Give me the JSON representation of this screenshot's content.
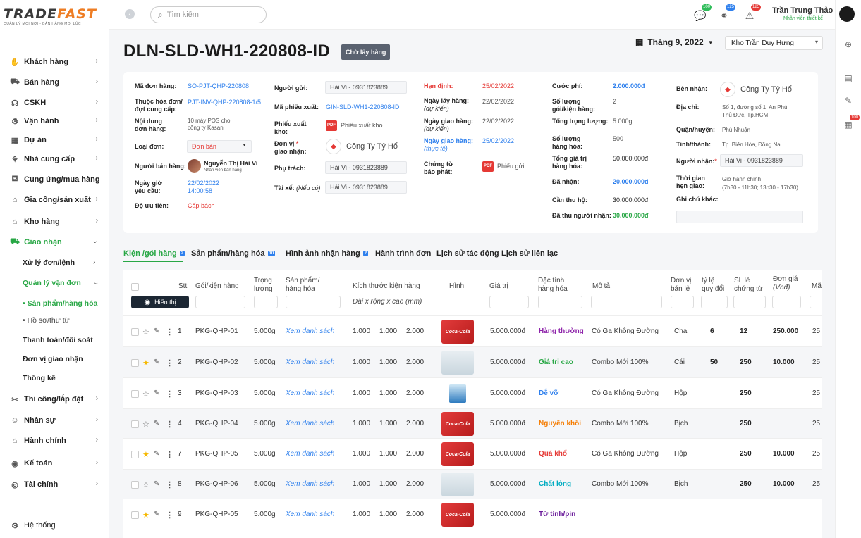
{
  "brand": {
    "name_a": "TRADE",
    "name_b": "FAST",
    "tagline": "QUẢN LÝ MỌI NƠI - BÁN HÀNG MỌI LÚC"
  },
  "sidebar": {
    "items": [
      {
        "label": "Khách hàng",
        "icon": "handshake-icon"
      },
      {
        "label": "Bán hàng",
        "icon": "cart-icon"
      },
      {
        "label": "CSKH",
        "icon": "headset-icon"
      },
      {
        "label": "Vận hành",
        "icon": "gear-icon"
      },
      {
        "label": "Dự án",
        "icon": "building-icon"
      },
      {
        "label": "Nhà cung cấp",
        "icon": "supplier-icon"
      },
      {
        "label": "Cung ứng/mua hàng",
        "icon": "basket-icon"
      },
      {
        "label": "Gia công/sản xuất",
        "icon": "factory-icon"
      },
      {
        "label": "Kho hàng",
        "icon": "warehouse-icon"
      },
      {
        "label": "Giao nhận",
        "icon": "truck-icon"
      },
      {
        "label": "Thi công/lắp đặt",
        "icon": "tools-icon"
      },
      {
        "label": "Nhân sự",
        "icon": "people-icon"
      },
      {
        "label": "Hành chính",
        "icon": "bank-icon"
      },
      {
        "label": "Kế toán",
        "icon": "coin-icon"
      },
      {
        "label": "Tài chính",
        "icon": "money-icon"
      }
    ],
    "sub": [
      "Xử lý đơn/lệnh",
      "Quản lý vận đơn",
      "Thanh toán/đối soát",
      "Đơn vị giao nhận",
      "Thống kê"
    ],
    "subsub": [
      "Sản phẩm/hàng hóa",
      "Hồ sơ/thư từ"
    ],
    "footer": "Hệ thống"
  },
  "topbar": {
    "search_placeholder": "Tìm kiếm",
    "badges": [
      "100",
      "125",
      "125"
    ],
    "user_name": "Trần Trung Thảo",
    "user_role": "Nhân viên thiết kế",
    "rail_badge": "100"
  },
  "page": {
    "title": "DLN-SLD-WH1-220808-ID",
    "status": "Chờ lấy hàng",
    "month": "Tháng 9, 2022",
    "warehouse": "Kho Trần Duy Hưng"
  },
  "info": {
    "ma_don_hang_l": "Mã đơn hàng:",
    "ma_don_hang": "SO-PJT-QHP-220808",
    "thuoc_hd_l1": "Thuộc hóa đơn/",
    "thuoc_hd_l2": "đợt cung cấp:",
    "thuoc_hd": "PJT-INV-QHP-220808-1/5",
    "noi_dung_l1": "Nội dung",
    "noi_dung_l2": "đơn hàng:",
    "noi_dung_1": "10 máy POS cho",
    "noi_dung_2": "công ty Kasan",
    "loai_don_l": "Loại đơn:",
    "loai_don": "Đơn bán",
    "nguoi_ban_l": "Người bán hàng:",
    "nguoi_ban": "Nguyễn Thị Hải Vi",
    "nguoi_ban_role": "Nhân viên bán hàng",
    "ngay_gio_l1": "Ngày giờ",
    "ngay_gio_l2": "yêu cầu:",
    "ngay_gio_1": "22/02/2022",
    "ngay_gio_2": "14:00:58",
    "uu_tien_l": "Độ ưu tiên:",
    "uu_tien": "Cấp bách",
    "nguoi_gui_l": "Người gửi:",
    "nguoi_gui": "Hải Vi - 0931823889",
    "ma_phieu_l": "Mã phiếu xuất:",
    "ma_phieu": "GIN-SLD-WH1-220808-ID",
    "phieu_xuat_l1": "Phiếu xuất",
    "phieu_xuat_l2": "kho:",
    "phieu_xuat": "Phiếu xuất kho",
    "don_vi_l1": "Đơn vị",
    "don_vi_l2": "giao nhận:",
    "don_vi": "Công Ty Tỷ Hổ",
    "phu_trach_l": "Phụ trách:",
    "phu_trach": "Hải Vi - 0931823889",
    "tai_xe_l": "Tài xế:",
    "tai_xe_note": "(Nếu có)",
    "tai_xe": "Hải Vi - 0931823889",
    "han_dinh_l": "Hạn định:",
    "han_dinh": "25/02/2022",
    "ngay_lay_l1": "Ngày lấy hàng:",
    "ngay_lay_l2": "(dự kiến)",
    "ngay_lay": "22/02/2022",
    "ngay_giao_l1": "Ngày giao hàng:",
    "ngay_giao_l2": "(dự kiến)",
    "ngay_giao": "22/02/2022",
    "ngay_giao_tt_l1": "Ngày giao hàng:",
    "ngay_giao_tt_l2": "(thực tế)",
    "ngay_giao_tt": "25/02/2022",
    "chung_tu_l1": "Chứng từ",
    "chung_tu_l2": "báo phát:",
    "chung_tu": "Phiếu gửi",
    "cuoc_phi_l": "Cước phí:",
    "cuoc_phi": "2.000.000đ",
    "so_luong_goi_l1": "Số lượng",
    "so_luong_goi_l2": "gói/kiện hàng:",
    "so_luong_goi": "2",
    "tong_tl_l": "Tổng trọng lượng:",
    "tong_tl": "5.000g",
    "sl_hh_l1": "Số lượng",
    "sl_hh_l2": "hàng hóa:",
    "sl_hh": "500",
    "tong_gt_l1": "Tổng giá trị",
    "tong_gt_l2": "hàng hóa:",
    "tong_gt": "50.000.000đ",
    "da_nhan_l": "Đã nhận:",
    "da_nhan": "20.000.000đ",
    "can_thu_l": "Cần thu hộ:",
    "can_thu": "30.000.000đ",
    "da_thu_l": "Đã thu người nhận:",
    "da_thu": "30.000.000đ",
    "ben_nhan_l": "Bên nhận:",
    "ben_nhan": "Công Ty Tỷ Hổ",
    "dia_chi_l": "Địa chỉ:",
    "dia_chi_1": "Số 1, đường số 1, An Phú",
    "dia_chi_2": "Thủ Đức, Tp.HCM",
    "quan_l": "Quận/huyện:",
    "quan": "Phú Nhuận",
    "tinh_l": "Tỉnh/thành:",
    "tinh": "Tp. Biên Hòa, Đồng Nai",
    "nguoi_nhan_l": "Người nhận:",
    "nguoi_nhan": "Hải Vi - 0931823889",
    "tg_hen_l1": "Thời gian",
    "tg_hen_l2": "hẹn giao:",
    "tg_hen_1": "Giờ hành chính",
    "tg_hen_2": "(7h30 - 11h30; 13h30 - 17h30)",
    "ghi_chu_l": "Ghi chú khác:"
  },
  "tabs": [
    {
      "label": "Kiện /gói hàng",
      "badge": "2"
    },
    {
      "label": "Sản phẩm/hàng hóa",
      "badge": "10"
    },
    {
      "label": "Hình ảnh nhận hàng",
      "badge": "2"
    },
    {
      "label": "Hành trình đơn",
      "badge": ""
    },
    {
      "label": "Lịch sử tác động",
      "badge": ""
    },
    {
      "label": "Lịch sử liên lạc",
      "badge": ""
    }
  ],
  "table": {
    "show_button": "Hiển thị",
    "headers": {
      "stt": "Stt",
      "goi": "Gói/kiện hàng",
      "trong1": "Trọng",
      "trong2": "lượng",
      "sp1": "Sản phẩm/",
      "sp2": "hàng hóa",
      "kt": "Kích thước kiện hàng",
      "kt_sub": "Dài x rộng x cao (mm)",
      "hinh": "Hình",
      "gia_tri": "Giá trị",
      "dt1": "Đặc tính",
      "dt2": "hàng hóa",
      "mo_ta": "Mô tả",
      "dv1": "Đơn vị",
      "dv2": "bán lẻ",
      "tl1": "tỷ lệ",
      "tl2": "quy đổi",
      "sl1": "SL lẻ",
      "sl2": "chứng từ",
      "dg1": "Đơn giá",
      "dg2": "(Vnđ)",
      "ma": "Mã"
    },
    "rows": [
      {
        "stt": "1",
        "code": "PKG-QHP-01",
        "weight": "5.000g",
        "link": "Xem danh sách",
        "d": "1.000",
        "w": "1.000",
        "h": "2.000",
        "img": "coke",
        "value": "5.000.000đ",
        "trait": "Hàng thường",
        "trait_color": "#8e24aa",
        "desc": "Có Ga Không Đường",
        "unit": "Chai",
        "ratio": "6",
        "qty": "12",
        "price": "250.000",
        "ma": "25",
        "starred": false
      },
      {
        "stt": "2",
        "code": "PKG-QHP-02",
        "weight": "5.000g",
        "link": "Xem danh sách",
        "d": "1.000",
        "w": "1.000",
        "h": "2.000",
        "img": "water",
        "value": "5.000.000đ",
        "trait": "Giá trị cao",
        "trait_color": "#28a745",
        "desc": "Combo Mới 100%",
        "unit": "Cái",
        "ratio": "50",
        "qty": "250",
        "price": "10.000",
        "ma": "25",
        "starred": true
      },
      {
        "stt": "3",
        "code": "PKG-QHP-03",
        "weight": "5.000g",
        "link": "Xem danh sách",
        "d": "1.000",
        "w": "1.000",
        "h": "2.000",
        "img": "paint",
        "value": "5.000.000đ",
        "trait": "Dễ vỡ",
        "trait_color": "#2f80ed",
        "desc": "Có Ga Không Đường",
        "unit": "Hộp",
        "ratio": "",
        "qty": "250",
        "price": "",
        "ma": "25",
        "starred": false
      },
      {
        "stt": "4",
        "code": "PKG-QHP-04",
        "weight": "5.000g",
        "link": "Xem danh sách",
        "d": "1.000",
        "w": "1.000",
        "h": "2.000",
        "img": "coke",
        "value": "5.000.000đ",
        "trait": "Nguyên khối",
        "trait_color": "#f57c00",
        "desc": "Combo Mới 100%",
        "unit": "Bịch",
        "ratio": "",
        "qty": "250",
        "price": "",
        "ma": "25",
        "starred": false
      },
      {
        "stt": "7",
        "code": "PKG-QHP-05",
        "weight": "5.000g",
        "link": "Xem danh sách",
        "d": "1.000",
        "w": "1.000",
        "h": "2.000",
        "img": "coke",
        "value": "5.000.000đ",
        "trait": "Quá khổ",
        "trait_color": "#e53935",
        "desc": "Có Ga Không Đường",
        "unit": "Hộp",
        "ratio": "",
        "qty": "250",
        "price": "10.000",
        "ma": "25",
        "starred": true
      },
      {
        "stt": "8",
        "code": "PKG-QHP-06",
        "weight": "5.000g",
        "link": "Xem danh sách",
        "d": "1.000",
        "w": "1.000",
        "h": "2.000",
        "img": "water",
        "value": "5.000.000đ",
        "trait": "Chất lỏng",
        "trait_color": "#00acc1",
        "desc": "Combo Mới 100%",
        "unit": "Bịch",
        "ratio": "",
        "qty": "250",
        "price": "10.000",
        "ma": "25",
        "starred": false
      },
      {
        "stt": "9",
        "code": "PKG-QHP-05",
        "weight": "5.000g",
        "link": "Xem danh sách",
        "d": "1.000",
        "w": "1.000",
        "h": "2.000",
        "img": "coke",
        "value": "5.000.000đ",
        "trait": "Từ tính/pin",
        "trait_color": "#6a1b9a",
        "desc": "",
        "unit": "",
        "ratio": "",
        "qty": "",
        "price": "",
        "ma": "",
        "starred": true
      }
    ]
  },
  "colors": {
    "accent": "#28a745",
    "link": "#2f80ed",
    "danger": "#e53935",
    "dark": "#1c2733"
  }
}
